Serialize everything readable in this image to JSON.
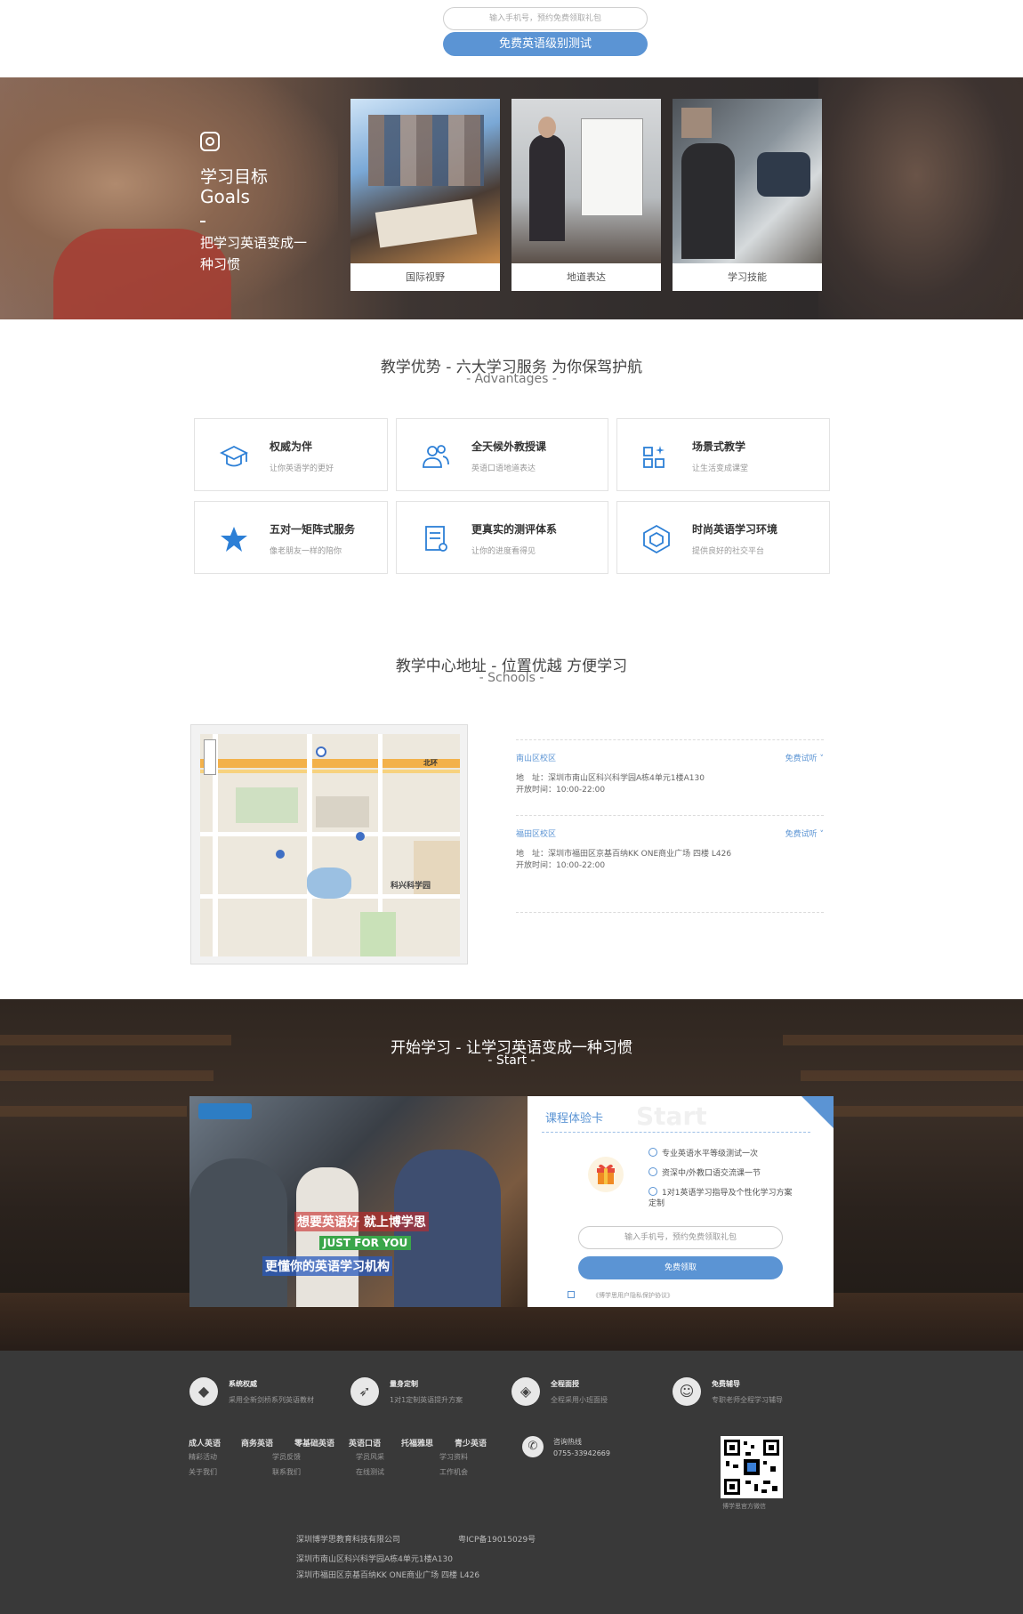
{
  "signup": {
    "phone_placeholder": "输入手机号，预约免费领取礼包",
    "button": "免费英语级别测试"
  },
  "goals": {
    "title_cn": "学习目标",
    "title_en": "Goals",
    "slogan": "把学习英语变成一种习惯",
    "cards": [
      {
        "label": "国际视野"
      },
      {
        "label": "地道表达"
      },
      {
        "label": "学习技能"
      }
    ]
  },
  "advantages": {
    "title": "教学优势 - 六大学习服务 为你保驾护航",
    "subtitle": "- Advantages -",
    "items": [
      {
        "icon": "graduation-cap-icon",
        "title": "权威为伴",
        "desc": "让你英语学的更好"
      },
      {
        "icon": "users-icon",
        "title": "全天候外教授课",
        "desc": "英语口语地道表达"
      },
      {
        "icon": "grid-sparkle-icon",
        "title": "场景式教学",
        "desc": "让生活变成课堂"
      },
      {
        "icon": "star-icon",
        "title": "五对一矩阵式服务",
        "desc": "像老朋友一样的陪你"
      },
      {
        "icon": "document-icon",
        "title": "更真实的测评体系",
        "desc": "让你的进度看得见"
      },
      {
        "icon": "cube-icon",
        "title": "时尚英语学习环境",
        "desc": "提供良好的社交平台"
      }
    ]
  },
  "schools": {
    "title": "教学中心地址 - 位置优越 方便学习",
    "subtitle": "- Schools -",
    "locations": [
      {
        "name": "南山区校区",
        "trial": "免费试听 ˅",
        "address": "地　址：深圳市南山区科兴科学园A栋4单元1楼A130",
        "hours": "开放时间：10:00-22:00"
      },
      {
        "name": "福田区校区",
        "trial": "免费试听 ˅",
        "address": "地　址：深圳市福田区京基百纳KK ONE商业广场 四楼 L426",
        "hours": "开放时间：10:00-22:00"
      }
    ],
    "map_labels": [
      "北环",
      "科兴科学园"
    ]
  },
  "start": {
    "title": "开始学习 - 让学习英语变成一种习惯",
    "subtitle": "- Start -",
    "photo_text": {
      "line1": "想要英语好 就上博学思",
      "line2": "JUST FOR YOU",
      "line3": "更懂你的英语学习机构"
    },
    "form": {
      "title": "课程体验卡",
      "ghost": "Start",
      "benefits": [
        "专业英语水平等级测试一次",
        "资深中/外教口语交流课一节",
        "1对1英语学习指导及个性化学习方案定制"
      ],
      "phone_placeholder": "输入手机号，预约免费领取礼包",
      "button": "免费领取",
      "agreement": "《博学思用户隐私保护协议》"
    }
  },
  "footer": {
    "features": [
      {
        "icon": "diamond-icon",
        "title": "系统权威",
        "desc": "采用全新剑桥系列英语教材"
      },
      {
        "icon": "rocket-icon",
        "title": "量身定制",
        "desc": "1对1定制英语提升方案"
      },
      {
        "icon": "graduation-cap-icon",
        "title": "全程面授",
        "desc": "全程采用小班面授"
      },
      {
        "icon": "user-icon",
        "title": "免费辅导",
        "desc": "专职老师全程学习辅导"
      }
    ],
    "nav_main": [
      "成人英语",
      "商务英语",
      "零基础英语",
      "英语口语",
      "托福雅思",
      "青少英语"
    ],
    "nav_sub": [
      "精彩活动",
      "学员反馈",
      "学员风采",
      "学习资料",
      "关于我们",
      "联系我们",
      "在线测试",
      "工作机会"
    ],
    "hotline_label": "咨询热线",
    "hotline": "0755-33942669",
    "qr_caption": "博学思官方微信",
    "company": "深圳博学思教育科技有限公司",
    "icp": "粤ICP备19015029号",
    "address1": "深圳市南山区科兴科学园A栋4单元1楼A130",
    "address2": "深圳市福田区京基百纳KK ONE商业广场 四楼 L426"
  }
}
